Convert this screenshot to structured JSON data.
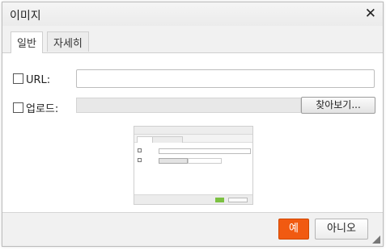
{
  "dialog": {
    "title": "이미지",
    "close_icon": "close-icon",
    "close_glyph": "✕"
  },
  "tabs": [
    {
      "label": "일반",
      "active": true
    },
    {
      "label": "자세히",
      "active": false
    }
  ],
  "url_row": {
    "label": "URL:",
    "checked": false,
    "value": ""
  },
  "upload_row": {
    "label": "업로드:",
    "checked": false,
    "browse_label": "찾아보기..."
  },
  "footer": {
    "yes_label": "예",
    "no_label": "아니오",
    "yes_color": "#f15a11"
  }
}
